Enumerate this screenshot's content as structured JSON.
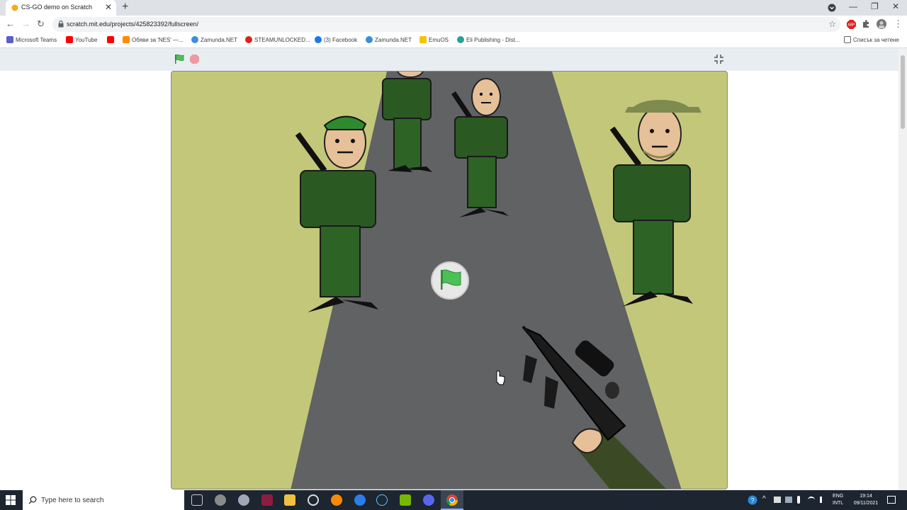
{
  "browser": {
    "tab_title": "CS-GO demo on Scratch",
    "tab_close": "✕",
    "new_tab": "+",
    "url": "scratch.mit.edu/projects/425823392/fullscreen/",
    "window": {
      "minimize": "—",
      "restore": "❐",
      "close": "✕"
    }
  },
  "bookmarks": [
    {
      "label": "Microsoft Teams",
      "color": "#5b5fc7"
    },
    {
      "label": "YouTube",
      "color": "#ff0000"
    },
    {
      "label": "",
      "color": "#ff0000"
    },
    {
      "label": "Обяви за 'NES' —...",
      "color": "#ff8c00"
    },
    {
      "label": "Zamunda.NET",
      "color": "#3b8fd6"
    },
    {
      "label": "STEAMUNLOCKED...",
      "color": "#e02020"
    },
    {
      "label": "(3) Facebook",
      "color": "#1877f2"
    },
    {
      "label": "Zamunda.NET",
      "color": "#3b8fd6"
    },
    {
      "label": "EmuOS",
      "color": "#f5c400"
    },
    {
      "label": "Eli Publishing - Dist...",
      "color": "#2aa198"
    }
  ],
  "reading_list": "Списък за четене",
  "taskbar": {
    "search_placeholder": "Type here to search",
    "lang_top": "ENG",
    "lang_bottom": "INTL",
    "time": "19:14",
    "date": "09/11/2021"
  },
  "colors": {
    "grass": "#c3c77a",
    "road": "#616264",
    "uniform": "#2a5a22",
    "skin": "#e6c098",
    "flag": "#4cbf56"
  }
}
